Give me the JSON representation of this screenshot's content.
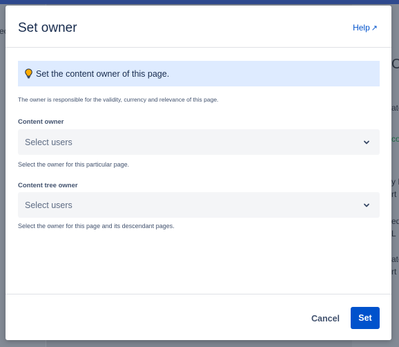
{
  "dialog": {
    "title": "Set owner",
    "help_label": "Help",
    "banner_text": "Set the content owner of this page.",
    "description": "The owner is responsible for the validity, currency and relevance of this page."
  },
  "content_owner": {
    "label": "Content owner",
    "placeholder": "Select users",
    "help": "Select the owner for this particular page."
  },
  "content_tree_owner": {
    "label": "Content tree owner",
    "placeholder": "Select users",
    "help": "Select the owner for this page and its descendant pages."
  },
  "footer": {
    "cancel_label": "Cancel",
    "set_label": "Set"
  },
  "background_fragments": {
    "left": [
      "ec"
    ],
    "right": [
      "C",
      "ate",
      "co",
      "y E",
      "rt",
      "ed",
      "L",
      "ate",
      "rt"
    ]
  },
  "colors": {
    "primary": "#0052cc",
    "banner_bg": "#deebff",
    "bulb": "#ffab00"
  }
}
